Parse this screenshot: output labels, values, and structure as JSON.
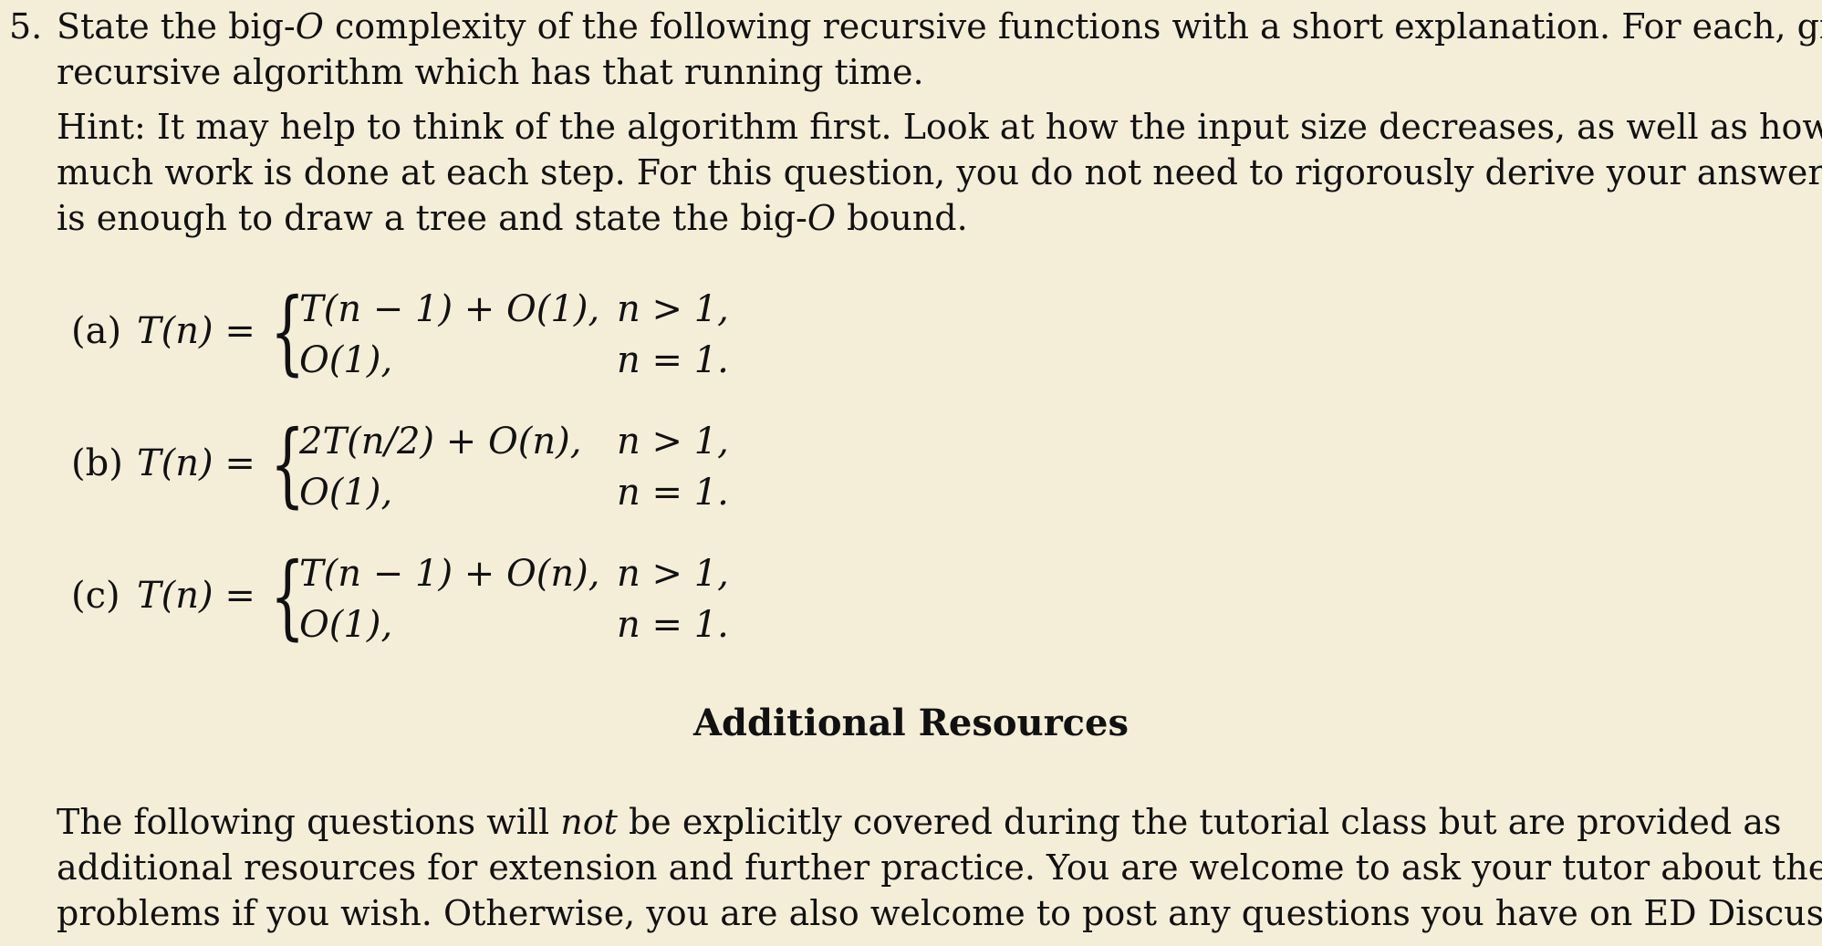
{
  "question": {
    "number": "5.",
    "intro_line1_a": "State the big-",
    "intro_line1_o": "O",
    "intro_line1_b": " complexity of the following recursive functions with a short explanation. For each, give a",
    "intro_line2": "recursive algorithm which has that running time.",
    "hint_line1": "Hint: It may help to think of the algorithm first. Look at how the input size decreases, as well as how",
    "hint_line2": "much work is done at each step. For this question, you do not need to rigorously derive your answers; it",
    "hint_line3_a": "is enough to draw a tree and state the big-",
    "hint_line3_o": "O",
    "hint_line3_b": " bound."
  },
  "recurrences": [
    {
      "label": "(a)",
      "lhs": "T(n) =",
      "case1_expr": "T(n − 1) + O(1),",
      "case1_cond": "n > 1,",
      "case2_expr": "O(1),",
      "case2_cond": "n = 1."
    },
    {
      "label": "(b)",
      "lhs": "T(n) =",
      "case1_expr": "2T(n/2) + O(n),",
      "case1_cond": "n > 1,",
      "case2_expr": "O(1),",
      "case2_cond": "n = 1."
    },
    {
      "label": "(c)",
      "lhs": "T(n) =",
      "case1_expr": "T(n − 1) + O(n),",
      "case1_cond": "n > 1,",
      "case2_expr": "O(1),",
      "case2_cond": "n = 1."
    }
  ],
  "resources": {
    "title": "Additional Resources",
    "line1_a": "The following questions will ",
    "line1_em": "not",
    "line1_b": " be explicitly covered during the tutorial class but are provided as",
    "line2": "additional resources for extension and further practice. You are welcome to ask your tutor about these",
    "line3": "problems if you wish. Otherwise, you are also welcome to post any questions you have on ED Discussion."
  }
}
